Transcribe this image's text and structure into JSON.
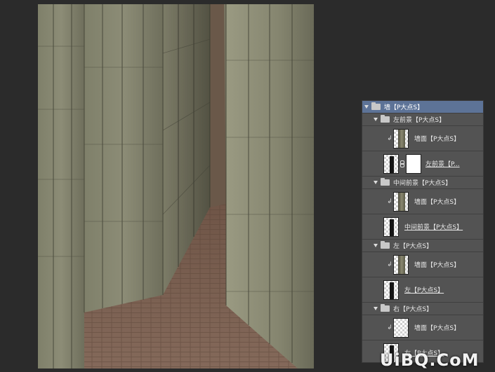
{
  "layers_panel": {
    "group_wall": "墙【P大点S】",
    "group_left_foreground": "左前景【P大点S】",
    "layer_wall_1": "墙面【P大点S】",
    "layer_left_foreground": "左前景【P...",
    "group_middle_foreground": "中间前景【P大点S】",
    "layer_wall_2": "墙面【P大点S】",
    "layer_middle_foreground": "中间前景【P大点S】",
    "group_left": "左【P大点S】",
    "layer_wall_3": "墙面【P大点S】",
    "layer_left": "左【P大点S】",
    "group_right": "右【P大点S】",
    "layer_wall_4": "墙面【P大点S】",
    "layer_right": "右【P大点S】"
  },
  "colors": {
    "selected_row": "#5d7397",
    "panel_bg": "#535353",
    "app_bg": "#2b2b2b",
    "wall_stone": "#8a8a74",
    "floor_brick": "#7a5f4d"
  },
  "watermark": "UiBQ.CoM"
}
